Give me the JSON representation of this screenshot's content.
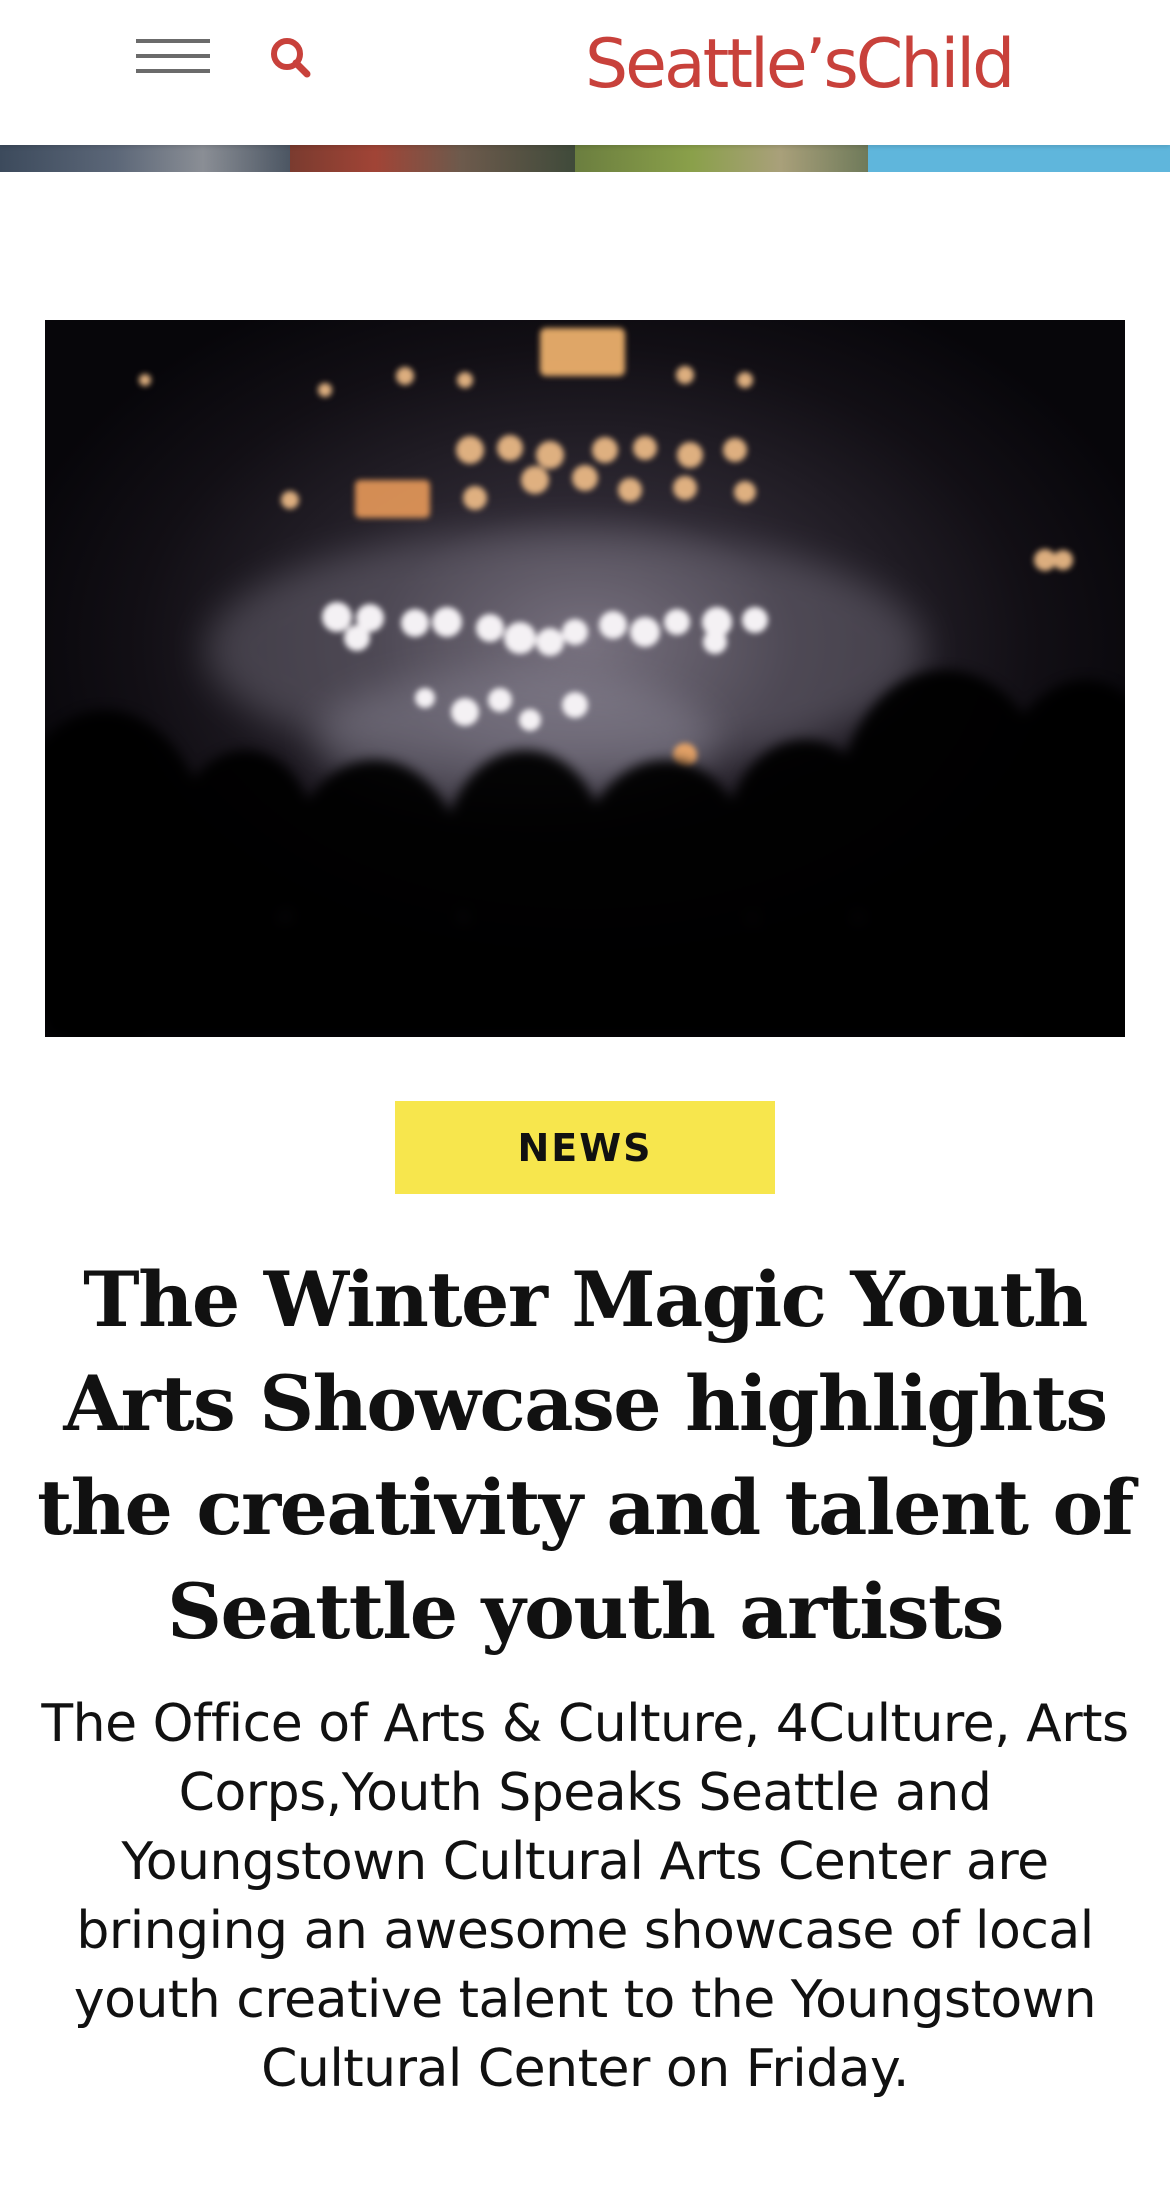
{
  "header": {
    "logo_text": "Seattle’sChild",
    "menu_icon": "hamburger-menu-icon",
    "search_icon": "search-icon",
    "brand_color": "#c8413b"
  },
  "article": {
    "category": "NEWS",
    "category_color": "#f7e64d",
    "headline": "The Winter Magic Youth Arts Showcase highlights the creativity and talent of Seattle youth artists",
    "dek": "The Office of Arts & Culture, 4Culture, Arts Corps,Youth Speaks Seattle and Youngstown Cultural Arts Center are bringing an awesome showcase of local youth creative talent to the Youngstown Cultural Center on Friday."
  }
}
